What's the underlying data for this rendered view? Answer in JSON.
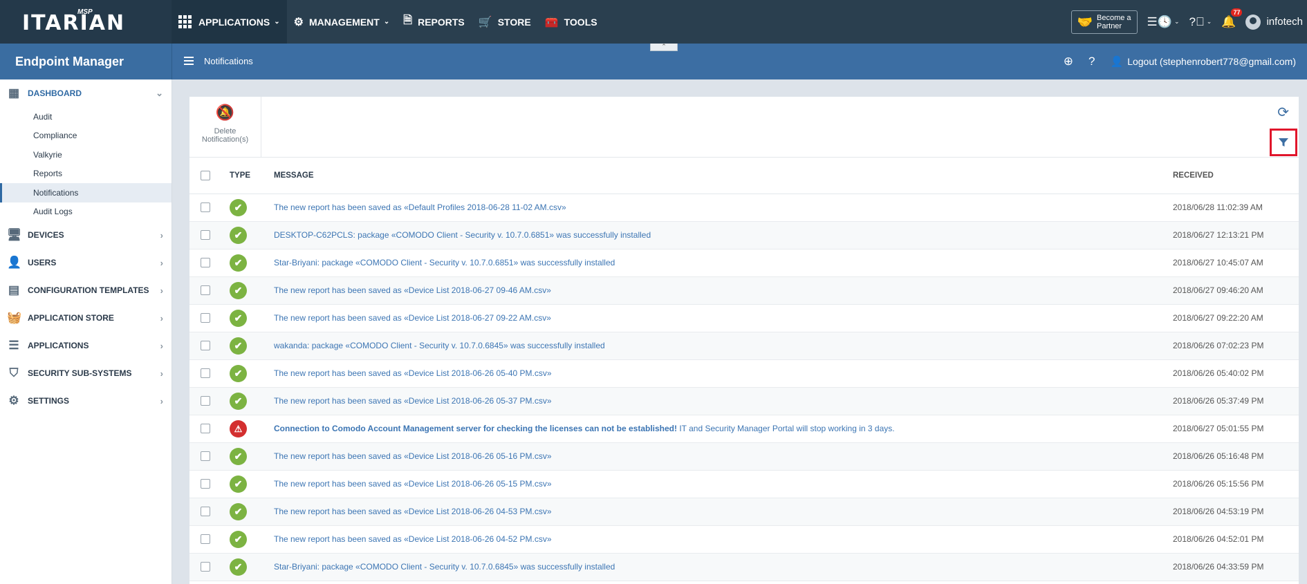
{
  "brand": {
    "logo": "ITARIAN",
    "msp": "MSP"
  },
  "nav": {
    "applications": "APPLICATIONS",
    "management": "MANAGEMENT",
    "reports": "REPORTS",
    "store": "STORE",
    "tools": "TOOLS"
  },
  "topright": {
    "partner_line1": "Become a",
    "partner_line2": "Partner",
    "notif_count": "77",
    "username": "infotech"
  },
  "header": {
    "product": "Endpoint Manager",
    "page": "Notifications",
    "logout": "Logout (stephenrobert778@gmail.com)"
  },
  "sidebar": {
    "dashboard": "DASHBOARD",
    "sub": [
      "Audit",
      "Compliance",
      "Valkyrie",
      "Reports",
      "Notifications",
      "Audit Logs"
    ],
    "sections": [
      "DEVICES",
      "USERS",
      "CONFIGURATION TEMPLATES",
      "APPLICATION STORE",
      "APPLICATIONS",
      "SECURITY SUB-SYSTEMS",
      "SETTINGS"
    ]
  },
  "toolbar": {
    "delete_line1": "Delete",
    "delete_line2": "Notification(s)"
  },
  "table": {
    "headers": {
      "type": "TYPE",
      "message": "MESSAGE",
      "received": "RECEIVED"
    },
    "rows": [
      {
        "status": "success",
        "message": "The new report has been saved as «Default Profiles 2018-06-28 11-02 AM.csv»",
        "received": "2018/06/28 11:02:39 AM"
      },
      {
        "status": "success",
        "message": "DESKTOP-C62PCLS: package «COMODO Client - Security v. 10.7.0.6851» was successfully installed",
        "received": "2018/06/27 12:13:21 PM"
      },
      {
        "status": "success",
        "message": "Star-Briyani: package «COMODO Client - Security v. 10.7.0.6851» was successfully installed",
        "received": "2018/06/27 10:45:07 AM"
      },
      {
        "status": "success",
        "message": "The new report has been saved as «Device List 2018-06-27 09-46 AM.csv»",
        "received": "2018/06/27 09:46:20 AM"
      },
      {
        "status": "success",
        "message": "The new report has been saved as «Device List 2018-06-27 09-22 AM.csv»",
        "received": "2018/06/27 09:22:20 AM"
      },
      {
        "status": "success",
        "message": "wakanda: package «COMODO Client - Security v. 10.7.0.6845» was successfully installed",
        "received": "2018/06/26 07:02:23 PM"
      },
      {
        "status": "success",
        "message": "The new report has been saved as «Device List 2018-06-26 05-40 PM.csv»",
        "received": "2018/06/26 05:40:02 PM"
      },
      {
        "status": "success",
        "message": "The new report has been saved as «Device List 2018-06-26 05-37 PM.csv»",
        "received": "2018/06/26 05:37:49 PM"
      },
      {
        "status": "warning",
        "message_bold": "Connection to Comodo Account Management server for checking the licenses can not be established!",
        "message": " IT and Security Manager Portal will stop working in 3 days.",
        "received": "2018/06/27 05:01:55 PM"
      },
      {
        "status": "success",
        "message": "The new report has been saved as «Device List 2018-06-26 05-16 PM.csv»",
        "received": "2018/06/26 05:16:48 PM"
      },
      {
        "status": "success",
        "message": "The new report has been saved as «Device List 2018-06-26 05-15 PM.csv»",
        "received": "2018/06/26 05:15:56 PM"
      },
      {
        "status": "success",
        "message": "The new report has been saved as «Device List 2018-06-26 04-53 PM.csv»",
        "received": "2018/06/26 04:53:19 PM"
      },
      {
        "status": "success",
        "message": "The new report has been saved as «Device List 2018-06-26 04-52 PM.csv»",
        "received": "2018/06/26 04:52:01 PM"
      },
      {
        "status": "success",
        "message": "Star-Briyani: package «COMODO Client - Security v. 10.7.0.6845» was successfully installed",
        "received": "2018/06/26 04:33:59 PM"
      }
    ]
  },
  "colors": {
    "topbar": "#2a3f4f",
    "header": "#3c6ea3",
    "success": "#7cb342",
    "warning": "#d32f2f",
    "highlight": "#e0152b"
  }
}
